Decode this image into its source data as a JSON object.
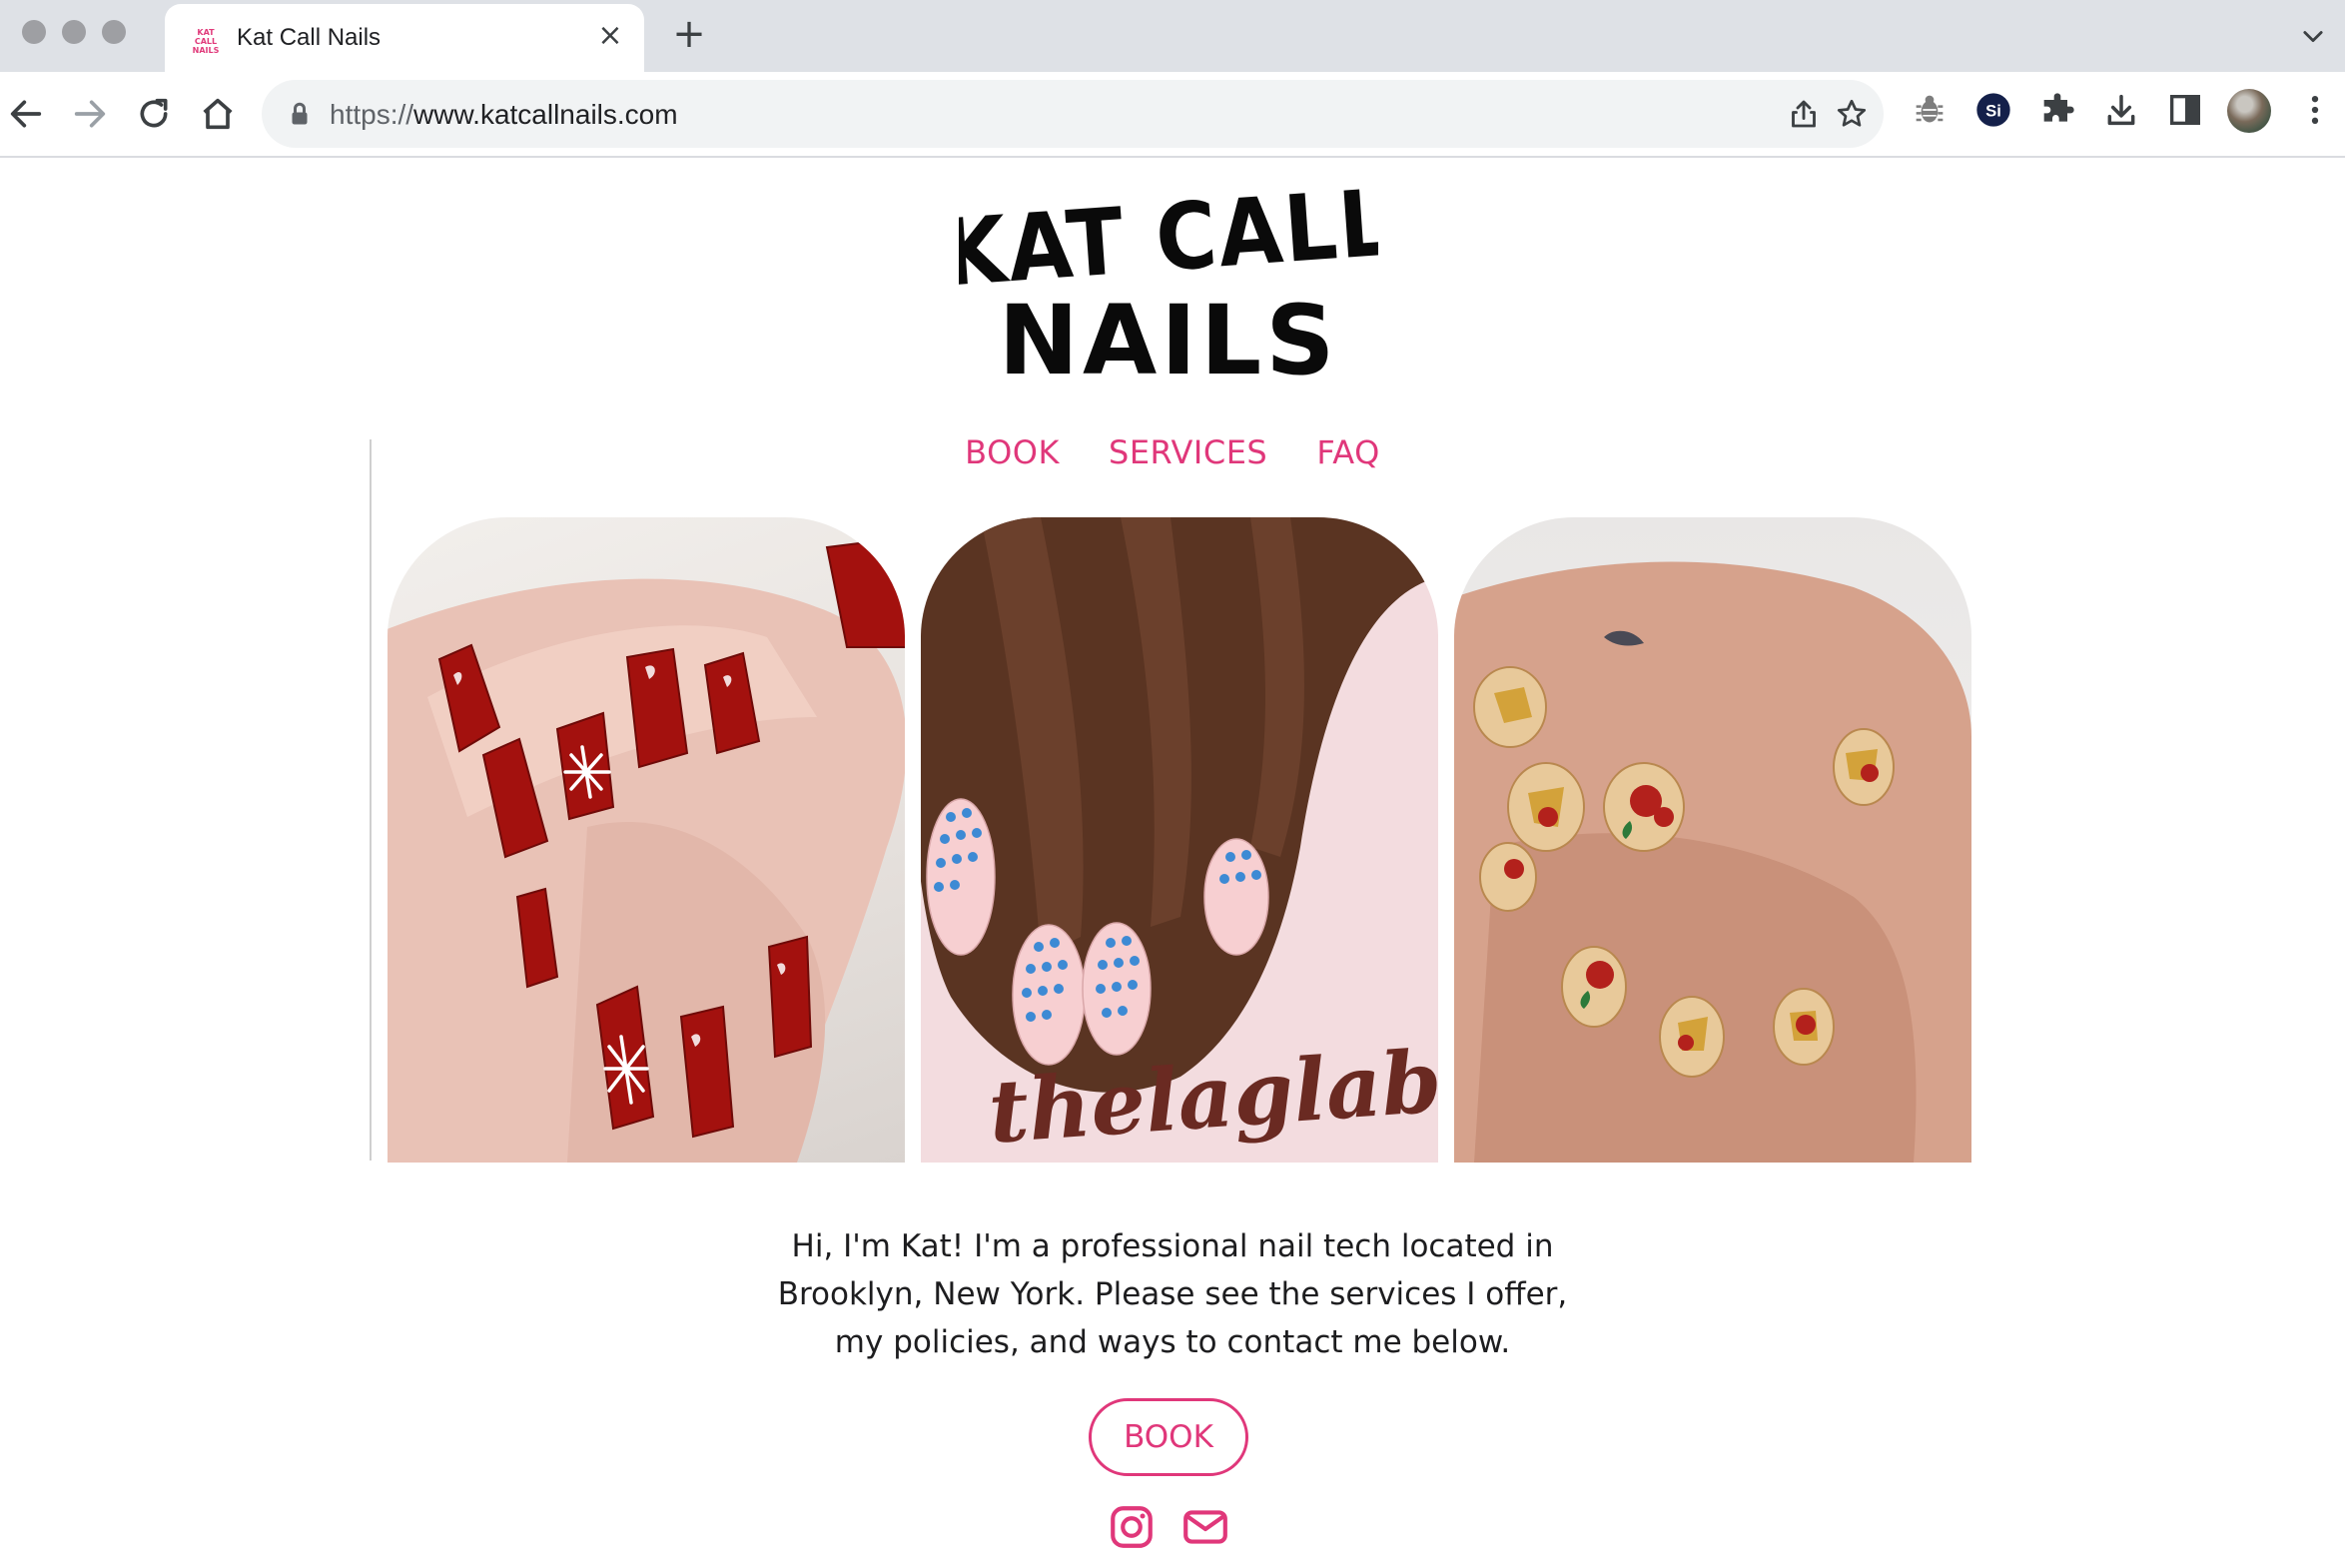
{
  "browser": {
    "tab_title": "Kat Call Nails",
    "favicon_text": "KAT CALL NAILS",
    "url_scheme": "https://",
    "url_host": "www.katcallnails.com",
    "extension_label": "Si"
  },
  "site": {
    "logo_text": "KAT CALL NAILS",
    "nav": [
      {
        "label": "BOOK"
      },
      {
        "label": "SERVICES"
      },
      {
        "label": "FAQ"
      }
    ],
    "intro_text": "Hi, I'm Kat! I'm a professional nail tech located in Brooklyn, New York. Please see the services I offer, my policies, and ways to contact me below.",
    "book_button": "BOOK",
    "gallery_watermark": "thelaglab",
    "accent_color": "#e0377a",
    "social_icons": [
      "instagram-icon",
      "mail-icon"
    ]
  }
}
